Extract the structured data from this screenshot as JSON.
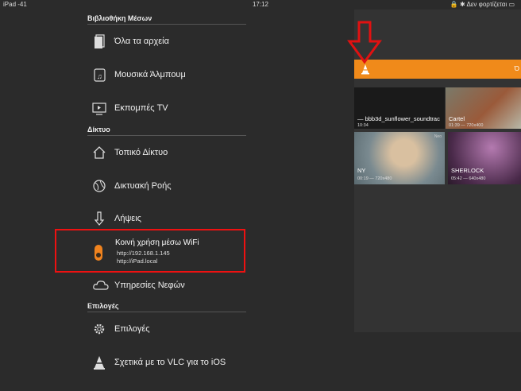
{
  "status_bar": {
    "device": "iPad",
    "signal": "-41",
    "time": "17:12",
    "battery_text": "Δεν φορτίζεται"
  },
  "sections": {
    "media_library": "Βιβλιοθήκη Μέσων",
    "network": "Δίκτυο",
    "options": "Επιλογές"
  },
  "menu": {
    "all_files": "Όλα τα αρχεία",
    "music_albums": "Μουσικά Άλμπουμ",
    "tv_shows": "Εκπομπές TV",
    "local_network": "Τοπικό Δίκτυο",
    "network_stream": "Δικτυακή Ροής",
    "downloads": "Λήψεις",
    "wifi_sharing": {
      "label": "Κοινή χρήση μέσω WiFi",
      "url1": "http://192.168.1.145",
      "url2": "http://iPad.local"
    },
    "cloud_services": "Υπηρεσίες Νεφών",
    "settings": "Επιλογές",
    "about": "Σχετικά με το VLC για το iOS"
  },
  "top_bar": {
    "edge_text": "Ό"
  },
  "videos": [
    {
      "title": "— bbb3d_sunflower_soundtrac",
      "meta": "10:34",
      "badge": ""
    },
    {
      "title": "Cartel",
      "meta": "01:39 — 720x400",
      "badge": ""
    },
    {
      "title": "NY",
      "meta": "00:19 — 720x480",
      "badge": "Neo"
    },
    {
      "title": "SHERLOCK",
      "meta": "05:42 — 640x480",
      "badge": ""
    }
  ],
  "colors": {
    "accent": "#f08a1a",
    "highlight": "#e11111",
    "sidebar_bg": "#2b2b2b"
  }
}
